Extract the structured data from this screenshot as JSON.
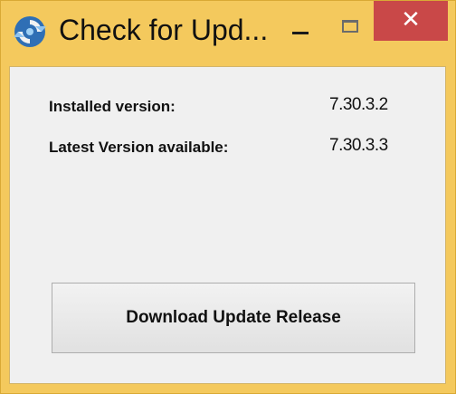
{
  "window": {
    "title": "Check for Upd...",
    "icon": "refresh-icon",
    "controls": {
      "minimize_icon": "minimize-icon",
      "maximize_icon": "maximize-icon",
      "close_label": "✕"
    },
    "frame_color": "#f4c95d",
    "close_color": "#c94848"
  },
  "content": {
    "installed_label": "Installed version:",
    "installed_value": "7.30.3.2",
    "latest_label": "Latest Version available:",
    "latest_value": "7.30.3.3",
    "download_button": "Download Update Release"
  }
}
